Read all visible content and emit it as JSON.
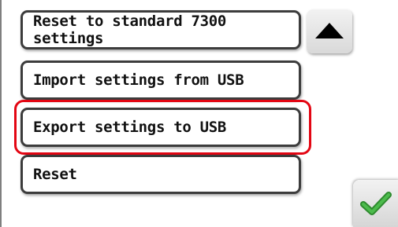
{
  "menu": {
    "items": [
      {
        "label": "Reset to standard 7300 settings"
      },
      {
        "label": "Import settings from USB"
      },
      {
        "label": "Export settings to USB",
        "selected": true
      },
      {
        "label": "Reset"
      }
    ]
  },
  "controls": {
    "scroll_up_icon": "triangle-up-icon",
    "confirm_icon": "checkmark-icon"
  },
  "colors": {
    "selection_outline": "#e30613",
    "checkmark": "#3aa53a",
    "button_border": "#3c3c3c"
  }
}
